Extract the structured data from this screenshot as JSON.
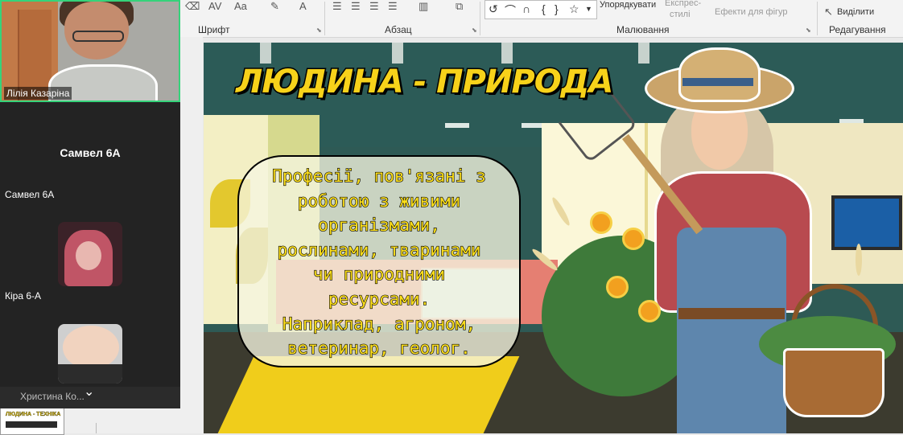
{
  "ribbon": {
    "groups": {
      "font": "Шрифт",
      "paragraph": "Абзац",
      "drawing": "Малювання",
      "editing": "Редагування"
    },
    "arrange_label": "Упорядкувати",
    "quick_styles_line1": "Експрес-",
    "quick_styles_line2": "стилі",
    "shape_effects_label": "Ефекти для фігур",
    "select_label": "Виділити"
  },
  "video_call": {
    "self_name": "Лілія Казаріна",
    "tile_title": "Самвел 6А",
    "participants": [
      {
        "name": "Самвел 6А"
      },
      {
        "name": "Кіра 6-А"
      },
      {
        "name": "Христина Ко..."
      }
    ]
  },
  "thumbnail": {
    "title": "ЛЮДИНА - ТЕХНІКА"
  },
  "slide": {
    "title": "ЛЮДИНА - ПРИРОДА",
    "bubble_lines": [
      "Професії, пов'язані з",
      "роботою з живими",
      "організмами,",
      "рослинами, тваринами",
      "чи природними",
      "ресурсами.",
      "Наприклад, агроном,",
      "ветеринар, геолог."
    ]
  }
}
